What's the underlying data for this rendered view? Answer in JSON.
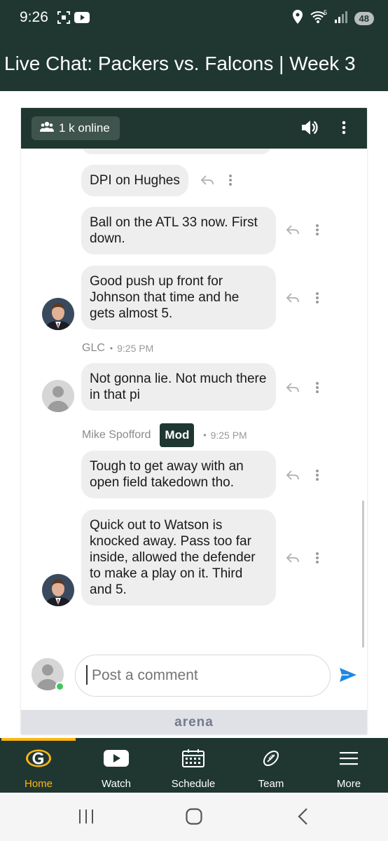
{
  "status_bar": {
    "time": "9:26",
    "battery": "48",
    "network": "5"
  },
  "header": {
    "title": "Live Chat: Packers vs. Falcons | Week 3"
  },
  "chat": {
    "online_count": "1 k online",
    "messages": [
      {
        "text": "DPI on Hughes"
      },
      {
        "text": "Ball on the ATL 33 now. First down."
      },
      {
        "text": "Good push up front for Johnson that time and he gets almost 5."
      },
      {
        "author": "GLC",
        "time": "9:25 PM",
        "text": "Not gonna lie. Not much there in that pi"
      },
      {
        "author": "Mike Spofford",
        "badge": "Mod",
        "time": "9:25 PM",
        "text": "Tough to get away with an open field takedown tho."
      },
      {
        "text": "Quick out to Watson is knocked away. Pass too far inside, allowed the defender to make a play on it. Third and 5."
      }
    ],
    "composer_placeholder": "Post a comment",
    "brand": "arena"
  },
  "bottom_nav": {
    "items": [
      {
        "label": "Home",
        "icon": "packers-g-logo-icon"
      },
      {
        "label": "Watch",
        "icon": "play-icon"
      },
      {
        "label": "Schedule",
        "icon": "calendar-icon"
      },
      {
        "label": "Team",
        "icon": "football-icon"
      },
      {
        "label": "More",
        "icon": "menu-icon"
      }
    ]
  },
  "colors": {
    "primary": "#203731",
    "accent": "#ffb612",
    "bubble": "#efeeee",
    "send": "#1e88e5"
  }
}
